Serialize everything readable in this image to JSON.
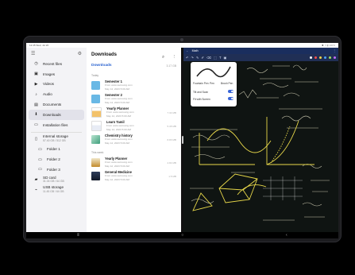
{
  "status_bar": {
    "time": "12:45 Wed, Jul 26",
    "right": "◾ ▾ ▮ 100%"
  },
  "files": {
    "sidebar": {
      "items": [
        {
          "icon": "clock-icon",
          "glyph": "◷",
          "label": "Recent files"
        },
        {
          "icon": "image-icon",
          "glyph": "▣",
          "label": "Images"
        },
        {
          "icon": "video-icon",
          "glyph": "▶",
          "label": "Videos"
        },
        {
          "icon": "audio-icon",
          "glyph": "♪",
          "label": "Audio"
        },
        {
          "icon": "document-icon",
          "glyph": "▤",
          "label": "Documents"
        },
        {
          "icon": "download-icon",
          "glyph": "⬇",
          "label": "Downloads"
        },
        {
          "icon": "installation-icon",
          "glyph": "▭",
          "label": "Installation files"
        }
      ],
      "storage": {
        "label": "Internal storage",
        "sub": "57.40 GB / 512 GB"
      },
      "folders": [
        "Folder 1",
        "Folder 2",
        "Folder 3"
      ],
      "sd": {
        "label": "SD card",
        "sub": "31.04 GB / 64 GB"
      },
      "usb": {
        "label": "USB storage",
        "sub": "11.45 GB / 64 GB"
      }
    },
    "main": {
      "title": "Downloads",
      "crumb": "Downloads",
      "size": "3.17 GB",
      "sections": [
        {
          "label": "Today",
          "rows": [
            {
              "name": "Semester 1",
              "meta": "From www.samsung.com",
              "date": "May 14, 2023 5:00 AM",
              "size": "",
              "thumb": "folder"
            },
            {
              "name": "Semester 2",
              "meta": "From www.samsung.com",
              "date": "May 14, 2023 5:00 AM",
              "size": "",
              "thumb": "folder"
            },
            {
              "name": "Yearly Planner",
              "meta": "From www.samsung.com",
              "date": "May 14, 2023 5:00 AM",
              "size": "7.34 MB",
              "thumb": "planner"
            },
            {
              "name": "Learn Tamil",
              "meta": "From www.samsung.com",
              "date": "May 14, 2023 5:00 AM",
              "size": "5.35 MB",
              "thumb": "doc"
            },
            {
              "name": "Chemistry history",
              "meta": "From www.samsung.com",
              "date": "May 14, 2023 5:00 AM",
              "size": "8.83 MB",
              "thumb": "chem"
            }
          ]
        },
        {
          "label": "This week",
          "rows": [
            {
              "name": "Yearly Planner",
              "meta": "From www.samsung.com",
              "date": "May 12, 2023 5:00 AM",
              "size": "4.84 MB",
              "thumb": "planner2"
            },
            {
              "name": "General Medicine",
              "meta": "From www.samsung.com",
              "date": "May 12, 2023 5:00 AM",
              "size": "1.5 MB",
              "thumb": "medicine"
            }
          ]
        }
      ]
    }
  },
  "notes": {
    "title": "Math",
    "pen_popup": {
      "option1": "Fountain Pen",
      "option2": "Pen",
      "option3": "Brush Pen",
      "setting1": "Tilt and Scan",
      "setting2": "Fit with Screen"
    },
    "colors": [
      "#ffffff",
      "#ff4d4d",
      "#f2d54a",
      "#4aa3ff",
      "#9de05a",
      "#c06cff"
    ]
  }
}
